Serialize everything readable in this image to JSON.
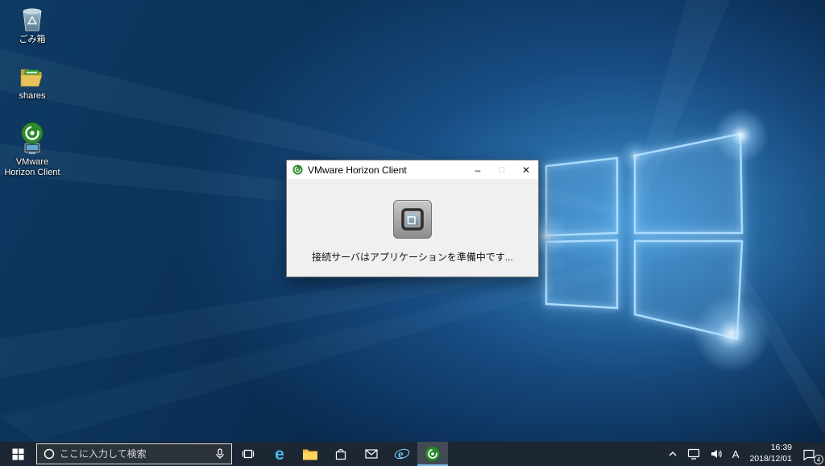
{
  "desktop": {
    "icons": [
      {
        "label": "ごみ箱"
      },
      {
        "label": "shares"
      },
      {
        "label": "VMware Horizon Client"
      }
    ]
  },
  "dialog": {
    "title": "VMware Horizon Client",
    "message": "接続サーバはアプリケーションを準備中です...",
    "controls": {
      "minimize": "–",
      "maximize": "□",
      "close": "✕"
    }
  },
  "taskbar": {
    "search": {
      "placeholder": "ここに入力して検索"
    },
    "tray": {
      "ime_label": "A",
      "time": "16:39",
      "date": "2018/12/01",
      "notification_count": "4"
    }
  },
  "icons": {
    "edge_glyph": "e",
    "ie_glyph": "e"
  },
  "colors": {
    "vmware_green": "#3fa037",
    "taskbar_bg": "#1c2733",
    "dialog_bg": "#f0f0f0",
    "wallpaper_blue": "#1e6eb5",
    "glow_blue": "#aadcff"
  }
}
